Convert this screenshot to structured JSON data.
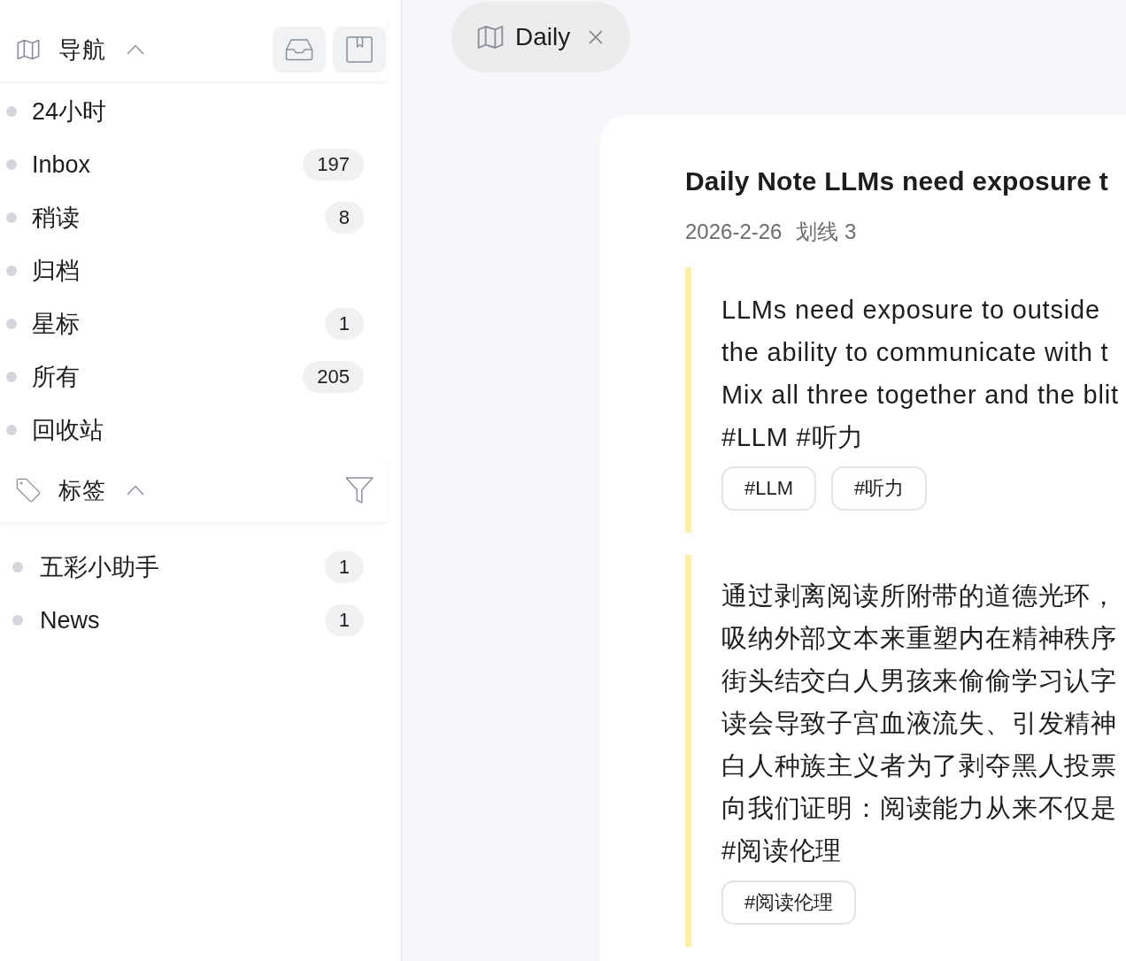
{
  "sidebar": {
    "nav": {
      "title": "导航",
      "expanded": true,
      "items": [
        {
          "label": "24小时"
        },
        {
          "label": "Inbox",
          "count": "197"
        },
        {
          "label": "稍读",
          "count": "8"
        },
        {
          "label": "归档"
        },
        {
          "label": "星标",
          "count": "1"
        },
        {
          "label": "所有",
          "count": "205"
        },
        {
          "label": "回收站"
        }
      ]
    },
    "tags": {
      "title": "标签",
      "expanded": true,
      "items": [
        {
          "label": "五彩小助手",
          "count": "1"
        },
        {
          "label": "News",
          "count": "1"
        }
      ]
    }
  },
  "tabs": [
    {
      "label": "Daily",
      "selected": true
    }
  ],
  "note": {
    "title": "Daily Note LLMs need exposure t",
    "date": "2026-2-26",
    "highlight_count": "划线 3",
    "highlights": [
      {
        "lines": [
          "LLMs need exposure to outside",
          "the ability to communicate with t",
          "Mix all three together and the blit",
          "#LLM #听力"
        ],
        "tags": [
          "#LLM",
          "#听力"
        ]
      },
      {
        "lines": [
          "通过剥离阅读所附带的道德光环，",
          "吸纳外部文本来重塑内在精神秩序",
          "街头结交白人男孩来偷偷学习认字",
          "读会导致子宫血液流失、引发精神",
          "白人种族主义者为了剥夺黑人投票",
          "向我们证明：阅读能力从来不仅是",
          "#阅读伦理"
        ],
        "tags": [
          "#阅读伦理"
        ]
      }
    ]
  }
}
